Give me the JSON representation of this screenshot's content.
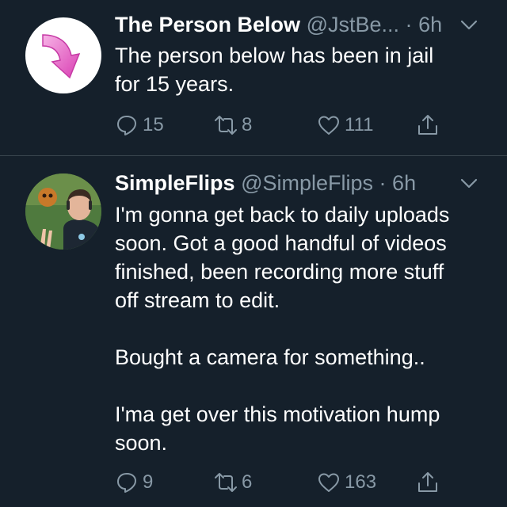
{
  "tweets": [
    {
      "name": "The Person Below",
      "handle": "@JstBe...",
      "separator": "·",
      "time": "6h",
      "text": "The person below has been in jail\nfor 15 years.",
      "replies": "15",
      "retweets": "8",
      "likes": "111",
      "avatar_icon": "pink-down-arrow-icon"
    },
    {
      "name": "SimpleFlips",
      "handle": "@SimpleFlips",
      "separator": "·",
      "time": "6h",
      "text": "I'm gonna get back to daily uploads\nsoon. Got a good handful of videos\nfinished, been recording more stuff\noff stream to edit.\n\nBought a camera for something..\n\nI'ma get over this motivation hump\nsoon.",
      "replies": "9",
      "retweets": "6",
      "likes": "163",
      "avatar_icon": "user-photo-avatar"
    }
  ],
  "colors": {
    "background": "#15202b",
    "divider": "#38444d",
    "secondary_text": "#8899a6",
    "primary_text": "#ffffff",
    "arrow_pink": "#e75fc4"
  }
}
